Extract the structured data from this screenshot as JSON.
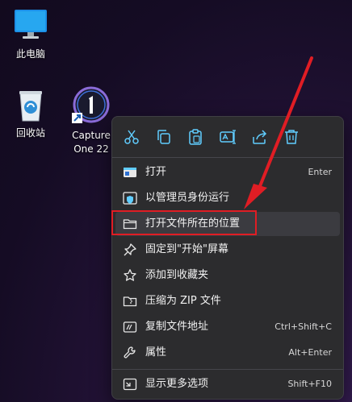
{
  "desktop": {
    "icons": [
      {
        "name": "this-pc",
        "label": "此电脑"
      },
      {
        "name": "recycle-bin",
        "label": "回收站"
      },
      {
        "name": "capture-one",
        "label_line1": "Capture",
        "label_line2": "One 22"
      }
    ]
  },
  "context_menu": {
    "toolbar": [
      "cut-icon",
      "copy-icon",
      "paste-icon",
      "rename-icon",
      "share-icon",
      "delete-icon"
    ],
    "items": [
      {
        "label": "打开",
        "shortcut": "Enter",
        "icon": "app-window-icon"
      },
      {
        "label": "以管理员身份运行",
        "shortcut": "",
        "icon": "admin-shield-icon"
      },
      {
        "label": "打开文件所在的位置",
        "shortcut": "",
        "icon": "folder-icon",
        "highlighted": true
      },
      {
        "label": "固定到\"开始\"屏幕",
        "shortcut": "",
        "icon": "pin-icon"
      },
      {
        "label": "添加到收藏夹",
        "shortcut": "",
        "icon": "star-icon"
      },
      {
        "label": "压缩为 ZIP 文件",
        "shortcut": "",
        "icon": "zip-folder-icon"
      },
      {
        "label": "复制文件地址",
        "shortcut": "Ctrl+Shift+C",
        "icon": "copy-path-icon"
      },
      {
        "label": "属性",
        "shortcut": "Alt+Enter",
        "icon": "wrench-icon"
      },
      {
        "label": "显示更多选项",
        "shortcut": "Shift+F10",
        "icon": "more-options-icon"
      }
    ]
  },
  "colors": {
    "annotation": "#e01d24",
    "menu_bg": "#2c2c2e",
    "highlight": "#3b3b40",
    "accent": "#60cdff"
  }
}
